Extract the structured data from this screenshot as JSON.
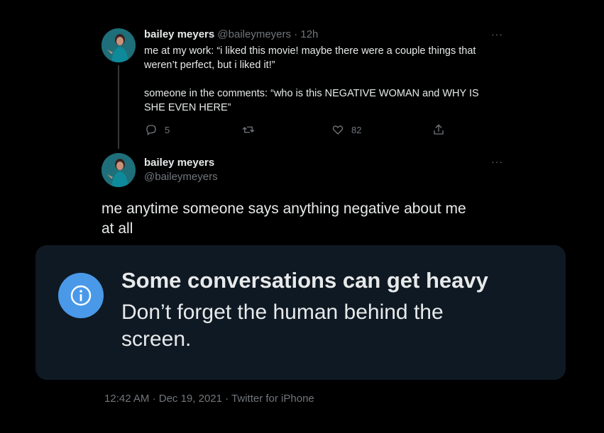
{
  "tweet1": {
    "name": "bailey meyers",
    "handle": "@baileymeyers",
    "separator": "·",
    "time": "12h",
    "more": "···",
    "text_line1": "me at my work: “i liked this movie! maybe there were a couple things that",
    "text_line2": "weren’t perfect, but i liked it!”",
    "text_line3": "someone in the comments: “who is this NEGATIVE WOMAN and WHY IS",
    "text_line4": "SHE EVEN HERE”",
    "reply_count": "5",
    "retweet_count": "",
    "like_count": "82"
  },
  "tweet2": {
    "name": "bailey meyers",
    "handle": "@baileymeyers",
    "more": "···",
    "text_line1": "me anytime someone says anything negative about me",
    "text_line2": "at all"
  },
  "notice": {
    "title": "Some conversations can get heavy",
    "body": "Don’t forget the human behind the screen."
  },
  "footer": {
    "time": "12:42 AM",
    "separator1": "·",
    "date": "Dec 19, 2021",
    "separator2": "·",
    "source": "Twitter for iPhone"
  },
  "colors": {
    "background": "#000000",
    "notice_bg": "#0f1923",
    "info_blue": "#4a99e9",
    "muted": "#71767b"
  },
  "icons": [
    "reply-icon",
    "retweet-icon",
    "like-icon",
    "share-icon",
    "info-icon",
    "more-icon"
  ]
}
